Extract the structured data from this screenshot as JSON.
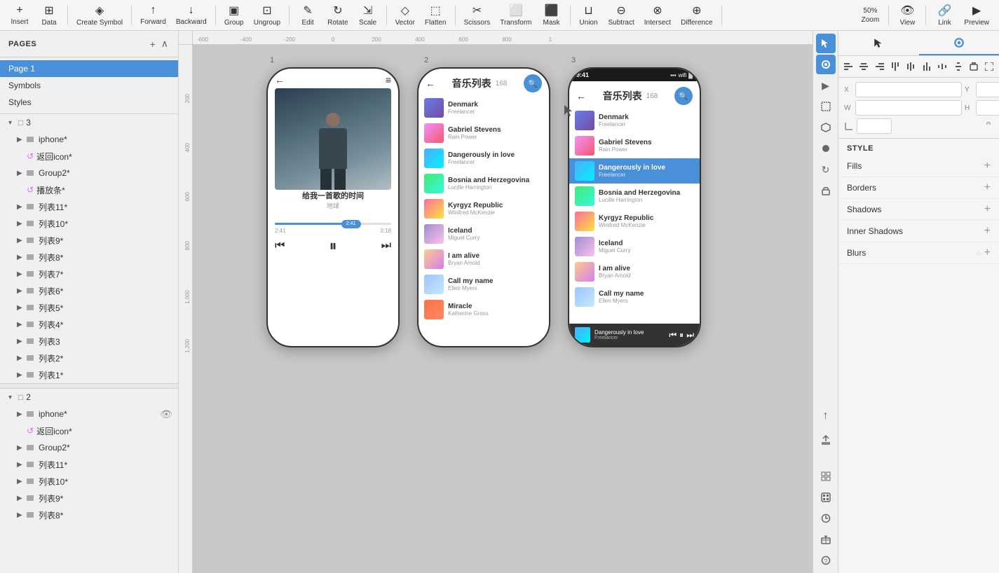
{
  "toolbar": {
    "buttons": [
      {
        "label": "Insert",
        "icon": "+"
      },
      {
        "label": "Data",
        "icon": "⊞"
      },
      {
        "label": "Create Symbol",
        "icon": "◈"
      },
      {
        "label": "Forward",
        "icon": "↑"
      },
      {
        "label": "Backward",
        "icon": "↓"
      },
      {
        "label": "Group",
        "icon": "▣"
      },
      {
        "label": "Ungroup",
        "icon": "⊡"
      },
      {
        "label": "Edit",
        "icon": "✎"
      },
      {
        "label": "Rotate",
        "icon": "↻"
      },
      {
        "label": "Scale",
        "icon": "⇲"
      },
      {
        "label": "Vector",
        "icon": "✦"
      },
      {
        "label": "Flatten",
        "icon": "⬚"
      },
      {
        "label": "Scissors",
        "icon": "✂"
      },
      {
        "label": "Transform",
        "icon": "⬜"
      },
      {
        "label": "Mask",
        "icon": "⬛"
      },
      {
        "label": "Union",
        "icon": "⊔"
      },
      {
        "label": "Subtract",
        "icon": "⊖"
      },
      {
        "label": "Intersect",
        "icon": "⊗"
      },
      {
        "label": "Difference",
        "icon": "⊕"
      },
      {
        "label": "Zoom",
        "value": "50%"
      },
      {
        "label": "View",
        "icon": "👁"
      },
      {
        "label": "Link",
        "icon": "🔗"
      },
      {
        "label": "Preview",
        "icon": "▶"
      }
    ]
  },
  "sidebar": {
    "title": "PAGES",
    "pages": [
      {
        "label": "Page 1",
        "active": true
      },
      {
        "label": "Symbols"
      },
      {
        "label": "Styles"
      }
    ],
    "layers": [
      {
        "group": "3",
        "indent": 0,
        "expanded": true,
        "items": [
          {
            "label": "iphone*",
            "icon": "folder",
            "indent": 1,
            "expanded": false
          },
          {
            "label": "返回icon*",
            "icon": "symbol",
            "indent": 1,
            "color": "#e066ff"
          },
          {
            "label": "Group2*",
            "icon": "folder",
            "indent": 1,
            "expanded": false
          },
          {
            "label": "播放条*",
            "icon": "symbol",
            "indent": 1,
            "color": "#e066ff"
          },
          {
            "label": "列表11*",
            "icon": "folder",
            "indent": 1,
            "expanded": false
          },
          {
            "label": "列表10*",
            "icon": "folder",
            "indent": 1,
            "expanded": false
          },
          {
            "label": "列表9*",
            "icon": "folder",
            "indent": 1,
            "expanded": false
          },
          {
            "label": "列表8*",
            "icon": "folder",
            "indent": 1,
            "expanded": false
          },
          {
            "label": "列表7*",
            "icon": "folder",
            "indent": 1,
            "expanded": false
          },
          {
            "label": "列表6*",
            "icon": "folder",
            "indent": 1,
            "expanded": false
          },
          {
            "label": "列表5*",
            "icon": "folder",
            "indent": 1,
            "expanded": false
          },
          {
            "label": "列表4*",
            "icon": "folder",
            "indent": 1,
            "expanded": false
          },
          {
            "label": "列表3",
            "icon": "folder",
            "indent": 1,
            "expanded": false
          },
          {
            "label": "列表2*",
            "icon": "folder",
            "indent": 1,
            "expanded": false
          },
          {
            "label": "列表1*",
            "icon": "folder",
            "indent": 1,
            "expanded": false
          }
        ]
      },
      {
        "group": "2",
        "indent": 0,
        "expanded": true,
        "items": [
          {
            "label": "iphone*",
            "icon": "folder",
            "indent": 1,
            "expanded": false,
            "hidden": true
          },
          {
            "label": "返回icon*",
            "icon": "symbol",
            "indent": 1,
            "color": "#e066ff"
          },
          {
            "label": "Group2*",
            "icon": "folder",
            "indent": 1,
            "expanded": false
          },
          {
            "label": "列表11*",
            "icon": "folder",
            "indent": 1,
            "expanded": false
          },
          {
            "label": "列表10*",
            "icon": "folder",
            "indent": 1,
            "expanded": false
          },
          {
            "label": "列表9*",
            "icon": "folder",
            "indent": 1,
            "expanded": false
          },
          {
            "label": "列表8*",
            "icon": "folder",
            "indent": 1,
            "expanded": false
          }
        ]
      }
    ]
  },
  "canvas": {
    "zoom": "50%",
    "rulers": [
      "-600",
      "-400",
      "-200",
      "0",
      "200",
      "400",
      "600",
      "800",
      "1"
    ],
    "vrulers": [
      "200",
      "400",
      "600",
      "800",
      "1,000",
      "1,200"
    ],
    "frames": [
      "1",
      "2",
      "3"
    ]
  },
  "frame1": {
    "song_title": "给我一首歌的时间",
    "song_artist": "地球",
    "progress_current": "2:41",
    "progress_total": "3:18",
    "progress_pct": 60
  },
  "frame2": {
    "title": "音乐列表",
    "count": "168",
    "songs": [
      {
        "title": "Denmark",
        "artist": "Freelancer"
      },
      {
        "title": "Gabriel Stevens",
        "artist": "Rain Power"
      },
      {
        "title": "Dangerously in love",
        "artist": "Freelancer"
      },
      {
        "title": "Bosnia and Herzegovina",
        "artist": "Lucille Harrington"
      },
      {
        "title": "Kyrgyz Republic",
        "artist": "Winifred McKenzie"
      },
      {
        "title": "Iceland",
        "artist": "Miguel Curry"
      },
      {
        "title": "I am alive",
        "artist": "Bryan Amold"
      },
      {
        "title": "Call my name",
        "artist": "Ellen Myers"
      },
      {
        "title": "Miracle",
        "artist": "Katherine Gross"
      }
    ]
  },
  "frame3": {
    "title": "音乐列表",
    "count": "168",
    "status_time": "9:41",
    "active_song": "Dangerously in love",
    "active_artist": "Freelancer",
    "songs": [
      {
        "title": "Denmark",
        "artist": "Freelancer"
      },
      {
        "title": "Gabriel Stevens",
        "artist": "Rain Power"
      },
      {
        "title": "Dangerously in love",
        "artist": "Freelancer",
        "active": true
      },
      {
        "title": "Bosnia and Herzegovina",
        "artist": "Lucille Harrington"
      },
      {
        "title": "Kyrgyz Republic",
        "artist": "Winifred McKenzie"
      },
      {
        "title": "Iceland",
        "artist": "Miguel Curry"
      },
      {
        "title": "I am alive",
        "artist": "Bryan Amold"
      },
      {
        "title": "Call my name",
        "artist": "Ellen Myers"
      },
      {
        "title": "Dangerously in love",
        "artist": "Freelancer"
      }
    ]
  },
  "right_panel": {
    "style_label": "STYLE",
    "fills_label": "Fills",
    "borders_label": "Borders",
    "shadows_label": "Shadows",
    "inner_shadows_label": "Inner Shadows",
    "blurs_label": "Blurs",
    "x_label": "X",
    "y_label": "Y",
    "w_label": "W",
    "h_label": "H"
  }
}
